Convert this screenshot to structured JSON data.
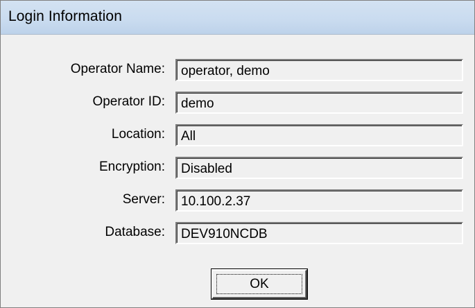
{
  "window": {
    "title": "Login Information"
  },
  "fields": [
    {
      "label": "Operator Name:",
      "value": "operator, demo"
    },
    {
      "label": "Operator ID:",
      "value": "demo"
    },
    {
      "label": "Location:",
      "value": "All"
    },
    {
      "label": "Encryption:",
      "value": "Disabled"
    },
    {
      "label": "Server:",
      "value": "10.100.2.37"
    },
    {
      "label": "Database:",
      "value": "DEV910NCDB"
    }
  ],
  "buttons": {
    "ok_label": "OK"
  },
  "colors": {
    "titlebar": "#c9dbef",
    "dialog_background": "#f0f0f0"
  }
}
